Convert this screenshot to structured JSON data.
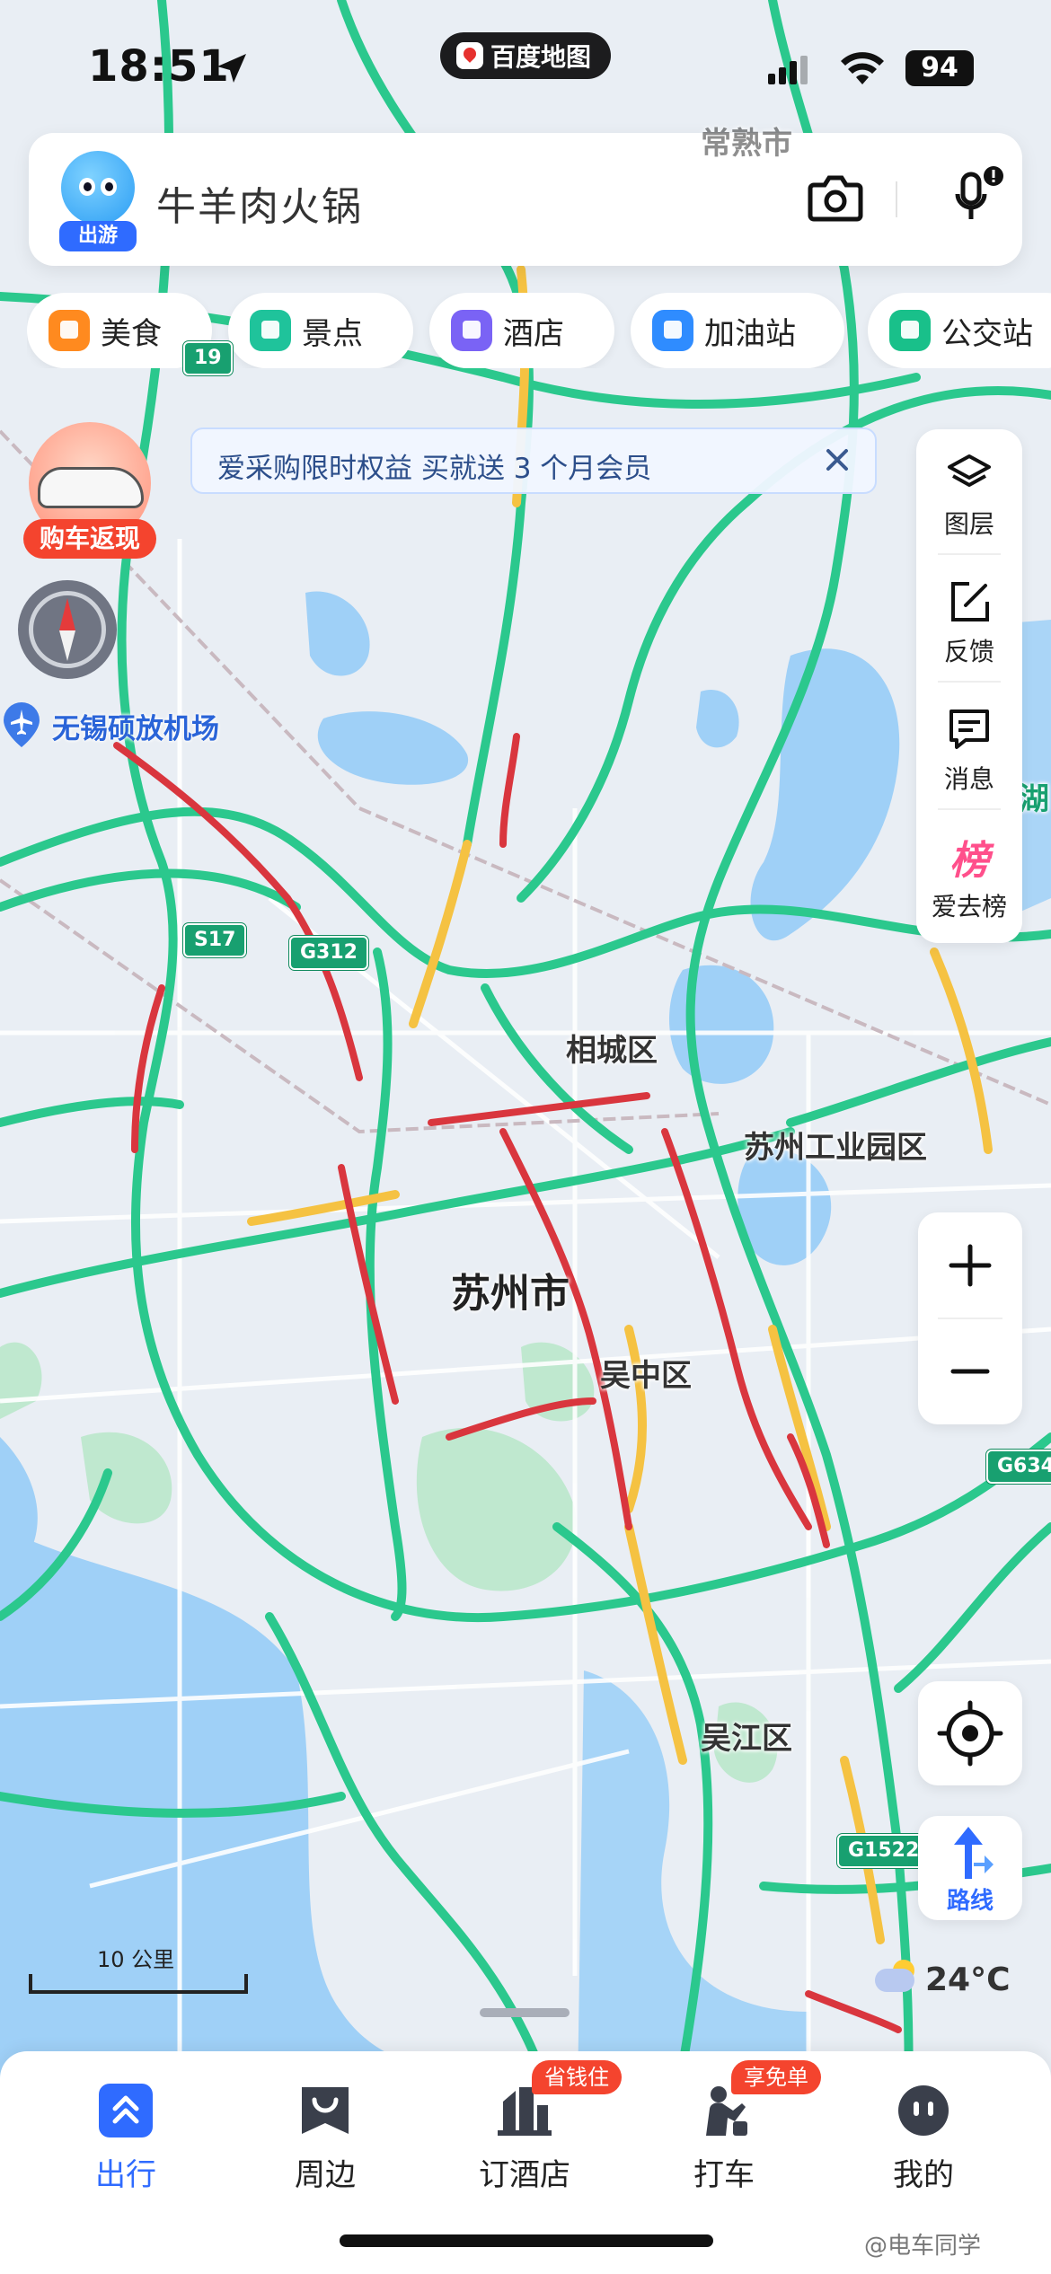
{
  "status_bar": {
    "time": "18:51",
    "app_name": "百度地图",
    "battery": "94"
  },
  "search": {
    "mascot_tag": "出游",
    "placeholder": "牛羊肉火锅"
  },
  "categories": [
    {
      "label": "美食",
      "color": "#ff8a1f",
      "icon": "food-icon"
    },
    {
      "label": "景点",
      "color": "#1fc39b",
      "icon": "scenic-icon"
    },
    {
      "label": "酒店",
      "color": "#7a63f5",
      "icon": "hotel-icon"
    },
    {
      "label": "加油站",
      "color": "#2f8cff",
      "icon": "gas-station-icon"
    },
    {
      "label": "公交站",
      "color": "#19c08a",
      "icon": "bus-stop-icon"
    }
  ],
  "promo": {
    "label": "购车返现"
  },
  "banner": {
    "text": "爱采购限时权益 买就送 3 个月会员"
  },
  "toolbar": {
    "layers": "图层",
    "feedback": "反馈",
    "messages": "消息",
    "ranking": "爱去榜",
    "ranking_glyph": "榜"
  },
  "map": {
    "airport": "无锡硕放机场",
    "districts": {
      "xiangcheng": "相城区",
      "industrial_park": "苏州工业园区",
      "city": "苏州市",
      "wuzhong": "吴中区",
      "wujiang": "吴江区",
      "lake_partial": "湖",
      "top_partial": "常熟市"
    },
    "road_shields": [
      "S17",
      "G312",
      "G634",
      "G1522",
      "19"
    ],
    "scale": "10 公里",
    "temperature": "24°C"
  },
  "route_button": {
    "label": "路线"
  },
  "bottom_nav": [
    {
      "label": "出行",
      "active": true,
      "icon": "travel-icon"
    },
    {
      "label": "周边",
      "active": false,
      "icon": "nearby-icon"
    },
    {
      "label": "订酒店",
      "active": false,
      "icon": "hotel-booking-icon",
      "badge": "省钱住"
    },
    {
      "label": "打车",
      "active": false,
      "icon": "taxi-icon",
      "badge": "享免单"
    },
    {
      "label": "我的",
      "active": false,
      "icon": "profile-icon"
    }
  ],
  "watermark": "@电车同学",
  "colors": {
    "accent": "#2f6bff",
    "road_free": "#2bc88d",
    "road_slow": "#f5c242",
    "road_jam": "#d9363e",
    "water": "#9fd0f7",
    "park": "#bfe8cf"
  }
}
